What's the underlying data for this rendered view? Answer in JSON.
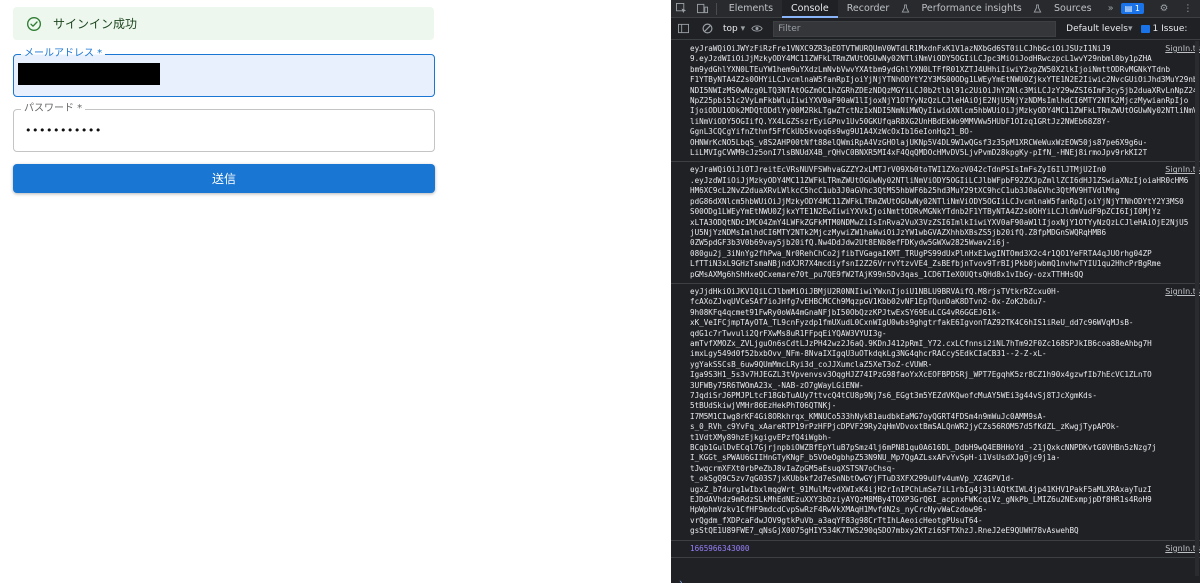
{
  "app": {
    "alert": {
      "message": "サインイン成功"
    },
    "email": {
      "label": "メールアドレス *"
    },
    "password": {
      "label": "パスワード *",
      "masked_value": "•••••••••••"
    },
    "submit_label": "送信",
    "colors": {
      "primary": "#1976d2",
      "success_bg": "#edf7ed",
      "success_icon": "#2e7d32"
    }
  },
  "devtools": {
    "tabs": [
      "Elements",
      "Console",
      "Recorder",
      "Performance insights",
      "Sources"
    ],
    "active_tab": "Console",
    "issues_badge": "1",
    "context": "top",
    "filter_placeholder": "Filter",
    "levels": "Default levels",
    "issues_label": "1 Issue:",
    "log_entries": [
      {
        "source": "SignIn.ts",
        "lines": [
          "eyJraWQiOiJWYzFiRzFre1VNXC9ZR3pEOTVTWURQUmV0WTdLR1MxdnFxK1V1azNXbGd6ST0iLCJhbGciOiJSUzI1NiJ9",
          "9.eyJzdWIiOiJjMzkyODY4MC11ZWFkLTRmZWUtOGUwNy02NTliNmViODY5OGIiLCJpc3MiOiJodHRwczpcL1wvY29nbml0by1pZHA",
          "bm9ydGhlYXN0LTEuYW1hem9uYXdzLmNvbVwvYXAtbm9ydGhlYXN0LTFfR01XZTJ4UHhiIiwiY2xpZW50X2lkIjoiNmttODRvMGNkYTdnb",
          "F1YTByNTA4Z2s0OHYiLCJvcmlnaW5fanRpIjoiYjNjYTNhODYtY2Y3MS00ODg1LWEyYmEtNWU0ZjkxYTE1N2E2Iiwic2NvcGUiOiJhd3MuY29nbml0",
          "NDI5NWIzMS0wNzg0LTQ3NTAtOGZmOC1hZGRhZDEzNDQzMGYiLCJ0b2tlbl91c2UiOiJhY2Nlc3MiLCJzY29wZSI6ImF3cy5jb2duaXRvLnNpZ24",
          "NpZ25pbi51c2VyLmFkbWluIiwiYXV0aF90aW1lIjoxNjY1OTYyNzQzLCJleHAiOjE2NjU5NjYzNDMsImlhdCI6MTY2NTk2MjczMywianRpIjo",
          "IjoiODU1ODk2MDQtODdlYy00M2RkLTgwZTctNzIxNDI5NmNiMWQyIiwidXNlcm5hbWUiOiJjMzkyODY4MC11ZWFkLTRmZWUtOGUwNy02NTliNmViO",
          "liNmViODY5OGIifQ.YX4LGZSszrEyiGPnv1Uv50GKUfqaR8XG2UnHBdEkWo9MMVWw5HUbF1OIzq1GRtJz2NWEb68Z8Y-",
          "GgnL3CQCgYifnZthnf5FfCkUb5kvoq6s9wg9U1A4XzWcOxIb16eIonHq21_BO-",
          "OHNWrKcNO5LbqS_v8S2AHP00tNft88elQWmiRpA4VzGHOlajUKNp5V4DL9W1wQGsf3z35pM1XRCWeWuxWzEOW50js87pe6X9g6u-",
          "LiLMVIgCVWM9cJz5onI7lsBNUdX4B_rQHvC0BNXR5MI4xF4QqQMDOcHMvDV5LjvPvmD28kpgKy-pIfN_-HNEj8irmoJpv9rkKI2T"
        ]
      },
      {
        "source": "SignIn.ts",
        "lines": [
          "eyJraWQiOiJiOTJreitEcVRsNUVFSWhvaGZZY2xLMTJrV09Xb0toTWI1ZXozV042cTdnPSIsImFsZyI6IlJTMjU2In0",
          ".eyJzdWIiOiJjMzkyODY4MC11ZWFkLTRmZWUtOGUwNy02NTliNmViODY5OGIiLCJlbWFpbF92ZXJpZmllZCI6dHJ1ZSwiaXNzIjoiaHR0cHM6",
          "HM6XC9cL2NvZ2duaXRvLWlkcC5hcC1ub3J0aGVhc3QtMS5hbWF6b25hd3MuY29tXC9hcC1ub3J0aGVhc3QtMV9HTVdlMng",
          "pdG86dXNlcm5hbWUiOiJjMzkyODY4MC11ZWFkLTRmZWUtOGUwNy02NTliNmViODY5OGIiLCJvcmlnaW5fanRpIjoiYjNjYTNhODYtY2Y3MS0",
          "S00ODg1LWEyYmEtNWU0ZjkxYTE1N2EwIiwiYXVkIjoiNmttODRvMGNkYTdnb2F1YTByNTA4Z2s0OHYiLCJldmVudF9pZCI6IjI0MjYz",
          "xLTA3ODQtNDc1MC04ZmY4LWFkZGFkMTM0NDMwZiIsInRva2VuX3VzZSI6ImlkIiwiYXV0aF90aW1lIjoxNjY1OTYyNzQzLCJleHAiOjE2NjU5",
          "jU5NjYzNDMsImlhdCI6MTY2NTk2MjczMywiZW1haWwiOiJzYW1wbGVAZXhhbXBsZS5jb20ifQ.Z8fpMDGnSWQRqHMB6",
          "0ZW5pdGF3b3V0b69vay5jb20ifQ.Nw4DdJdw2Ut8ENb8efFDKydw5GWXw2825Wwav2i6j-",
          "080gu2j_3iNnYg2fhPwa_Nr0RehChCo2jfibTVGagaIKMT_TRUgPS99dUxPlnHxE1wgINTOmd3X2c4r1QO1YeFRTA4qJUOrhg04ZP",
          "LfTTiN3xL9GHzTsmaNBjndXJR7X4mcdiyfsnI2Z26VrrvYtzvVE4_ZsBEfbjnTvov9TrBIjPkb0jwbmQ1nvhwTYIU1qu2HhcPrBgRme",
          "pGMsAXMg6hShHxeQCxemare70t_pu7QE9fW2TAjK99n5Dv3qas_1CD6TIeX0UQtsQHd8x1vIbGy-ozxTTHHsQQ"
        ]
      },
      {
        "source": "SignIn.ts",
        "lines": [
          "eyJjdHkiOiJKV1QiLCJlbmMiOiJBMjU2R0NNIiwiYWxnIjoiU1NBLU9BRVAifQ.M8rjsTVtkrRZcxu0H-",
          "fcAXoZJvqUVCeSAf7ioJHfg7vEHBCMCCh9MqzpGV1Kbb02vNF1EpTQunDaK8DTvn2-0x-ZoK2bdu7-",
          "9h08KFq4qcmet91FwRy0oWA4mGnaNFjbI50ObQzzKPJtwExSY69EuLCG4vR6GGEJ61k-",
          "xK_VeIFCjmpTAyOTA_TL9cnFyzdp1fmUXudL0CxnWIgU0wbs9ghgtrfakE6IgvonTAZ92TK4C6hIS1iReU_dd7c96WVqMJsB-",
          "qdG1c7rTwvuli2QrFXwMs8uR1FFpqEiYQAW3VYUI3g-",
          "amTvfXMOZx_ZVLjguOn6sCdtLJzPH42wz2J6aQ.9KDnJ412pRmI_Y72.cxLCfnnsi2iNL7hTm92F0Zc168SPJkIB6coa88eAhbg7H",
          "imxLgy549d0f52bxbOvv_NFm-8NvaIXIgqU3uOTkdqkLg3NG4qhcrRACcySEdkCIaCB31--2-Z-xL-",
          "ygYakSSCsB_6uw9QUmMmcLRyi3d_coJJXumclaZ5XeT3oZ-cVUWR-",
          "Iga9S3H1_5s3v7HJEGZL3tVpvenvsv3OqgHJZ74IPzG98faoYxXcEOFBPDSRj_WPT7EgqhK5zr8CZ1h90x4gzwfIb7hEcVC1ZLnTO",
          "3UFWBy75R6TWOmA23x_-NAB-zO7gWayLGiENW-",
          "7JqdiSrJ6PMJPLtcF18GbTuAUy7ttvcQ4tCU8p9Nj7s6_EGgt3m5YEZdVKQwofcMuAY5WEi3g44vSj8TJcXgmKds-",
          "5tBUdSkiwjVMHr86EzHekPhT06QTNKj-",
          "I7M5M1CIwg8rKF4Gi8ORkhrqx_KMNUCo533hNyk81audbkEaMG7oyQGRT4FDSm4n9mWuJc0AMM9sA-",
          "s_0_RVh_c9YvFq_xAareRTP19rPzHFPjcDPVF29Ry2qHmVDvoxtBmSALQnWR2jyCZs56ROM57d5fKdZL_zKwgjTypAPOk-",
          "t1VdtXMy89hzEjkgigvEPzfQ4iWgbh-",
          "BCqb1GulDvECql7GjrjnpbiOWZBfEpYluB7pSmz4lj6mPN81qu0A616DL_DdbH9wQ4EBHHoYd_-21jQxkcNNPDKvtG0VHBn5zNzg7j",
          "I_KGGt_sPWAU6GIIHnGTyKNgF_b5VOeOgbhpZ53N9NU_Mp7QgAZLsxAFvYvSpH-i1VsUsdXJg0jc9j1a-",
          "tJwqcrmXFXt0rbPeZbJ8vIaZpGM5aEsuqXSTSN7oChsq-",
          "t_okSgQ9C5zv7qG03S7jxKUbbkf2d7eSnNbtOwGYjFTuD3XFX299uUfv4umVp_XZ4GPV1d-",
          "ugxZ_b7durg1wIbxlmqgWrt_91MulMzvdXWIxK4ijH2rInIPChLmSe7iL1rbIg4j31iAQtKIWL4jp41KHV1PakF5aMLXRAxayTuzI",
          "EJDdAVhdz9mRdzSLkMhEdNEzuXXY3bDziyAYQzM8MBy4TOXP3GrQ6I_acpnxFWKcqiVz_gNkPb_LMIZ6u2NExmpjpDf8HR1s4RoH9",
          "HpWphmVzkv1CfHF9mdcdCvpSwRzF4RwVkXMAqH1MvfdN2s_nyCrcNyvWaCzdow96-",
          "vrQgdm_fXDPcaFdwJOV9gtkPuVb_a3aqYF83g98CrTtIhLAeoicHeotgPUsuT64-",
          "gsStQE1U89FWE7_qNsGjX0075gHIY534K7TWS290qSDO7mbxy2KTzi6SFTXhzJ.RneJ2eE9QUWH78vAswehBQ"
        ]
      },
      {
        "source": "SignIn.ts",
        "lines": [
          "1665966343000"
        ]
      }
    ]
  }
}
